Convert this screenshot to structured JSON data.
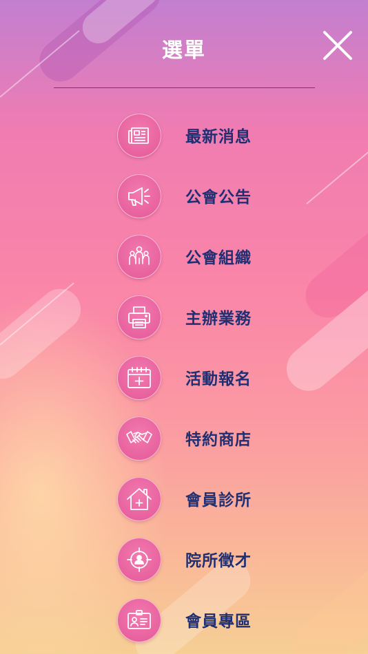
{
  "header": {
    "title": "選單",
    "close_icon": "close-x-icon"
  },
  "menu": {
    "items": [
      {
        "label": "最新消息",
        "icon": "newspaper-icon"
      },
      {
        "label": "公會公告",
        "icon": "megaphone-icon"
      },
      {
        "label": "公會組織",
        "icon": "group-people-icon"
      },
      {
        "label": "主辦業務",
        "icon": "printer-icon"
      },
      {
        "label": "活動報名",
        "icon": "calendar-add-icon"
      },
      {
        "label": "特約商店",
        "icon": "handshake-icon"
      },
      {
        "label": "會員診所",
        "icon": "clinic-house-icon"
      },
      {
        "label": "院所徵才",
        "icon": "target-person-icon"
      },
      {
        "label": "會員專區",
        "icon": "id-card-icon"
      }
    ]
  },
  "colors": {
    "label_text": "#1f2f72",
    "icon_circle": "#e9629f",
    "title_text": "#ffffff"
  }
}
